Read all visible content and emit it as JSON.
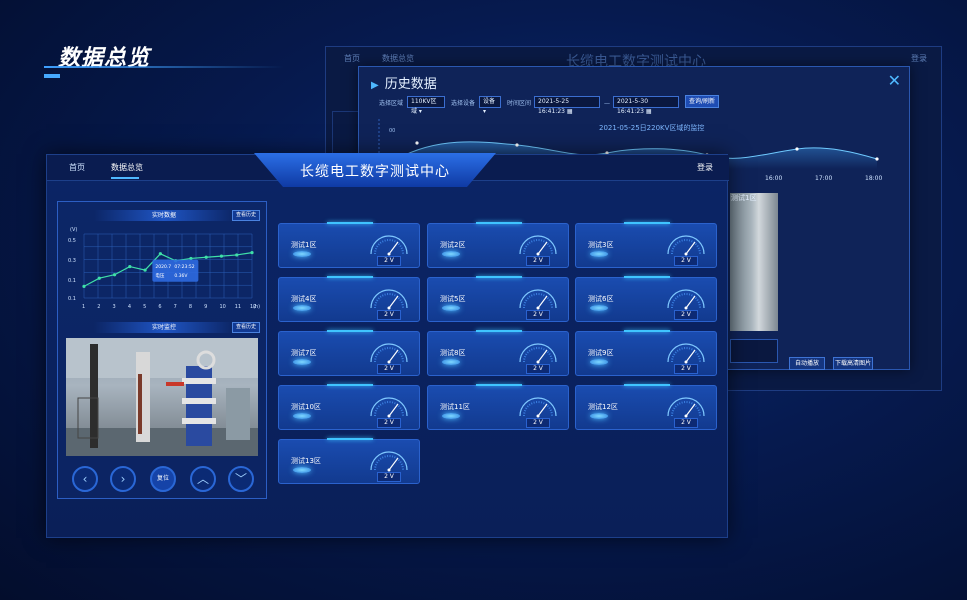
{
  "page": {
    "heading": "数据总览"
  },
  "back_window": {
    "nav": [
      "首页",
      "数据总览"
    ],
    "title": "长缆电工数字测试中心",
    "login": "登录"
  },
  "history_modal": {
    "title": "历史数据",
    "close_symbol": "✕",
    "region_label": "选择区域",
    "region_value": "110KV区域",
    "device_label": "选择设备",
    "device_value": "设备",
    "time_label": "时间区间",
    "start": "2021-5-25  16:41:23",
    "dash": "—",
    "end": "2021-5-30  16:41:23",
    "query_label": "查询/刷新",
    "chart_title": "2021-05-25日220KV区域的监控",
    "y_tick": "00",
    "x_ticks": [
      "16:00",
      "17:00",
      "18:00"
    ],
    "photo_label": "测试1区",
    "auto_play": "自动播放",
    "download": "下载高清图片"
  },
  "front": {
    "nav": {
      "home": "首页",
      "overview": "数据总览"
    },
    "title": "长缆电工数字测试中心",
    "login": "登录",
    "realtime_data": "实时数据",
    "view_history": "查看历史",
    "realtime_monitor": "实时监控",
    "controls": {
      "reset": "复位"
    }
  },
  "colors": {
    "accent": "#4fb8ff",
    "bg": "#061a4f",
    "card": "#1a4cb0"
  },
  "chart_data": {
    "type": "line",
    "ylabel": "(V)",
    "xlabel": "(h)",
    "x": [
      1,
      2,
      3,
      4,
      5,
      6,
      7,
      8,
      9,
      10,
      11,
      12
    ],
    "values": [
      0.1,
      0.17,
      0.2,
      0.27,
      0.24,
      0.38,
      0.32,
      0.34,
      0.35,
      0.36,
      0.37,
      0.39
    ],
    "y_ticks": [
      "0.5",
      "0.3",
      "0.1",
      "0.1"
    ],
    "x_ticks": [
      "1",
      "2",
      "3",
      "4",
      "5",
      "6",
      "7",
      "8",
      "9",
      "10",
      "11",
      "12"
    ],
    "ylim": [
      0,
      0.55
    ],
    "grid": true,
    "tooltip": {
      "time_label": "2020.7",
      "time_value": "07:23:52",
      "value_label": "电压",
      "value": "0.36V"
    }
  },
  "cards": [
    {
      "label": "测试1区",
      "value": "2 V"
    },
    {
      "label": "测试2区",
      "value": "2 V"
    },
    {
      "label": "测试3区",
      "value": "2 V"
    },
    {
      "label": "测试4区",
      "value": "2 V"
    },
    {
      "label": "测试5区",
      "value": "2 V"
    },
    {
      "label": "测试6区",
      "value": "2 V"
    },
    {
      "label": "测试7区",
      "value": "2 V"
    },
    {
      "label": "测试8区",
      "value": "2 V"
    },
    {
      "label": "测试9区",
      "value": "2 V"
    },
    {
      "label": "测试10区",
      "value": "2 V"
    },
    {
      "label": "测试11区",
      "value": "2 V"
    },
    {
      "label": "测试12区",
      "value": "2 V"
    },
    {
      "label": "测试13区",
      "value": "2 V"
    }
  ]
}
